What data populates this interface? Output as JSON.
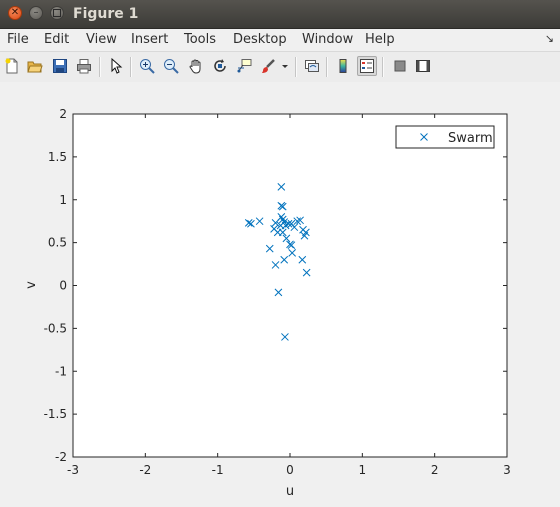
{
  "window": {
    "title": "Figure 1"
  },
  "menu": [
    "File",
    "Edit",
    "View",
    "Insert",
    "Tools",
    "Desktop",
    "Window",
    "Help"
  ],
  "menu_overflow_icon": "arrow-icon",
  "toolbar": {
    "buttons": [
      "new-figure-icon",
      "open-file-icon",
      "save-icon",
      "print-icon",
      "select-arrow-icon",
      "zoom-in-icon",
      "zoom-out-icon",
      "pan-hand-icon",
      "rotate-3d-icon",
      "data-cursor-icon",
      "brush-icon",
      "brush-dropdown-icon",
      "link-plot-icon",
      "insert-colorbar-icon",
      "insert-legend-icon",
      "hide-plot-tools-icon",
      "show-plot-tools-icon"
    ],
    "pressed": "insert-legend-icon"
  },
  "colors": {
    "marker": "#0072bd",
    "axes_bg": "#ffffff",
    "figure_bg": "#f0f0f0"
  },
  "chart_data": {
    "type": "scatter",
    "marker": "x",
    "xlabel": "u",
    "ylabel": "v",
    "xlim": [
      -3,
      3
    ],
    "ylim": [
      -2,
      2
    ],
    "xticks": [
      "-3",
      "-2",
      "-1",
      "0",
      "1",
      "2",
      "3"
    ],
    "yticks": [
      "-2",
      "-1.5",
      "-1",
      "-0.5",
      "0",
      "0.5",
      "1",
      "1.5",
      "2"
    ],
    "grid": false,
    "legend": {
      "entries": [
        "Swarm"
      ],
      "location": "top-right"
    },
    "series": [
      {
        "name": "Swarm",
        "points": [
          [
            -0.12,
            1.15
          ],
          [
            -0.12,
            0.93
          ],
          [
            -0.1,
            0.92
          ],
          [
            -0.57,
            0.73
          ],
          [
            -0.54,
            0.72
          ],
          [
            -0.42,
            0.75
          ],
          [
            -0.2,
            0.73
          ],
          [
            -0.22,
            0.66
          ],
          [
            -0.17,
            0.62
          ],
          [
            -0.12,
            0.8
          ],
          [
            -0.1,
            0.77
          ],
          [
            -0.08,
            0.74
          ],
          [
            -0.13,
            0.7
          ],
          [
            -0.06,
            0.7
          ],
          [
            -0.02,
            0.72
          ],
          [
            0.02,
            0.72
          ],
          [
            0.06,
            0.68
          ],
          [
            0.1,
            0.75
          ],
          [
            0.14,
            0.76
          ],
          [
            0.18,
            0.65
          ],
          [
            0.22,
            0.62
          ],
          [
            0.2,
            0.58
          ],
          [
            -0.1,
            0.62
          ],
          [
            -0.05,
            0.55
          ],
          [
            0.0,
            0.48
          ],
          [
            0.02,
            0.47
          ],
          [
            -0.28,
            0.43
          ],
          [
            0.03,
            0.38
          ],
          [
            -0.08,
            0.3
          ],
          [
            0.17,
            0.3
          ],
          [
            -0.2,
            0.24
          ],
          [
            0.23,
            0.15
          ],
          [
            -0.16,
            -0.08
          ],
          [
            -0.07,
            -0.6
          ]
        ]
      }
    ]
  }
}
